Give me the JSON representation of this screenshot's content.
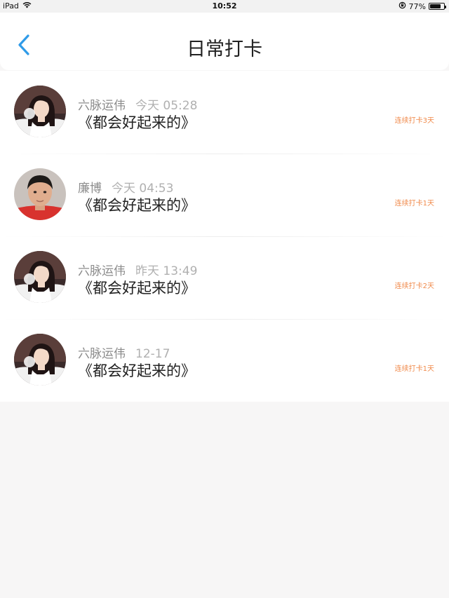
{
  "status_bar": {
    "device": "iPad",
    "time": "10:52",
    "battery": "77%",
    "battery_level": 0.77
  },
  "header": {
    "back_icon": "chevron-left-icon",
    "title": "日常打卡",
    "accent_color": "#2f9be8"
  },
  "checkins": [
    {
      "user": "六脉运伟",
      "time": "今天 05:28",
      "content": "《都会好起来的》",
      "streak": "连续打卡3天",
      "avatar": "girl"
    },
    {
      "user": "廉博",
      "time": "今天 04:53",
      "content": "《都会好起来的》",
      "streak": "连续打卡1天",
      "avatar": "boy"
    },
    {
      "user": "六脉运伟",
      "time": "昨天 13:49",
      "content": "《都会好起来的》",
      "streak": "连续打卡2天",
      "avatar": "girl"
    },
    {
      "user": "六脉运伟",
      "time": "12-17",
      "content": "《都会好起来的》",
      "streak": "连续打卡1天",
      "avatar": "girl"
    }
  ],
  "colors": {
    "streak": "#f08a4b",
    "name": "#8c8c8c",
    "background": "#f7f6f6"
  }
}
